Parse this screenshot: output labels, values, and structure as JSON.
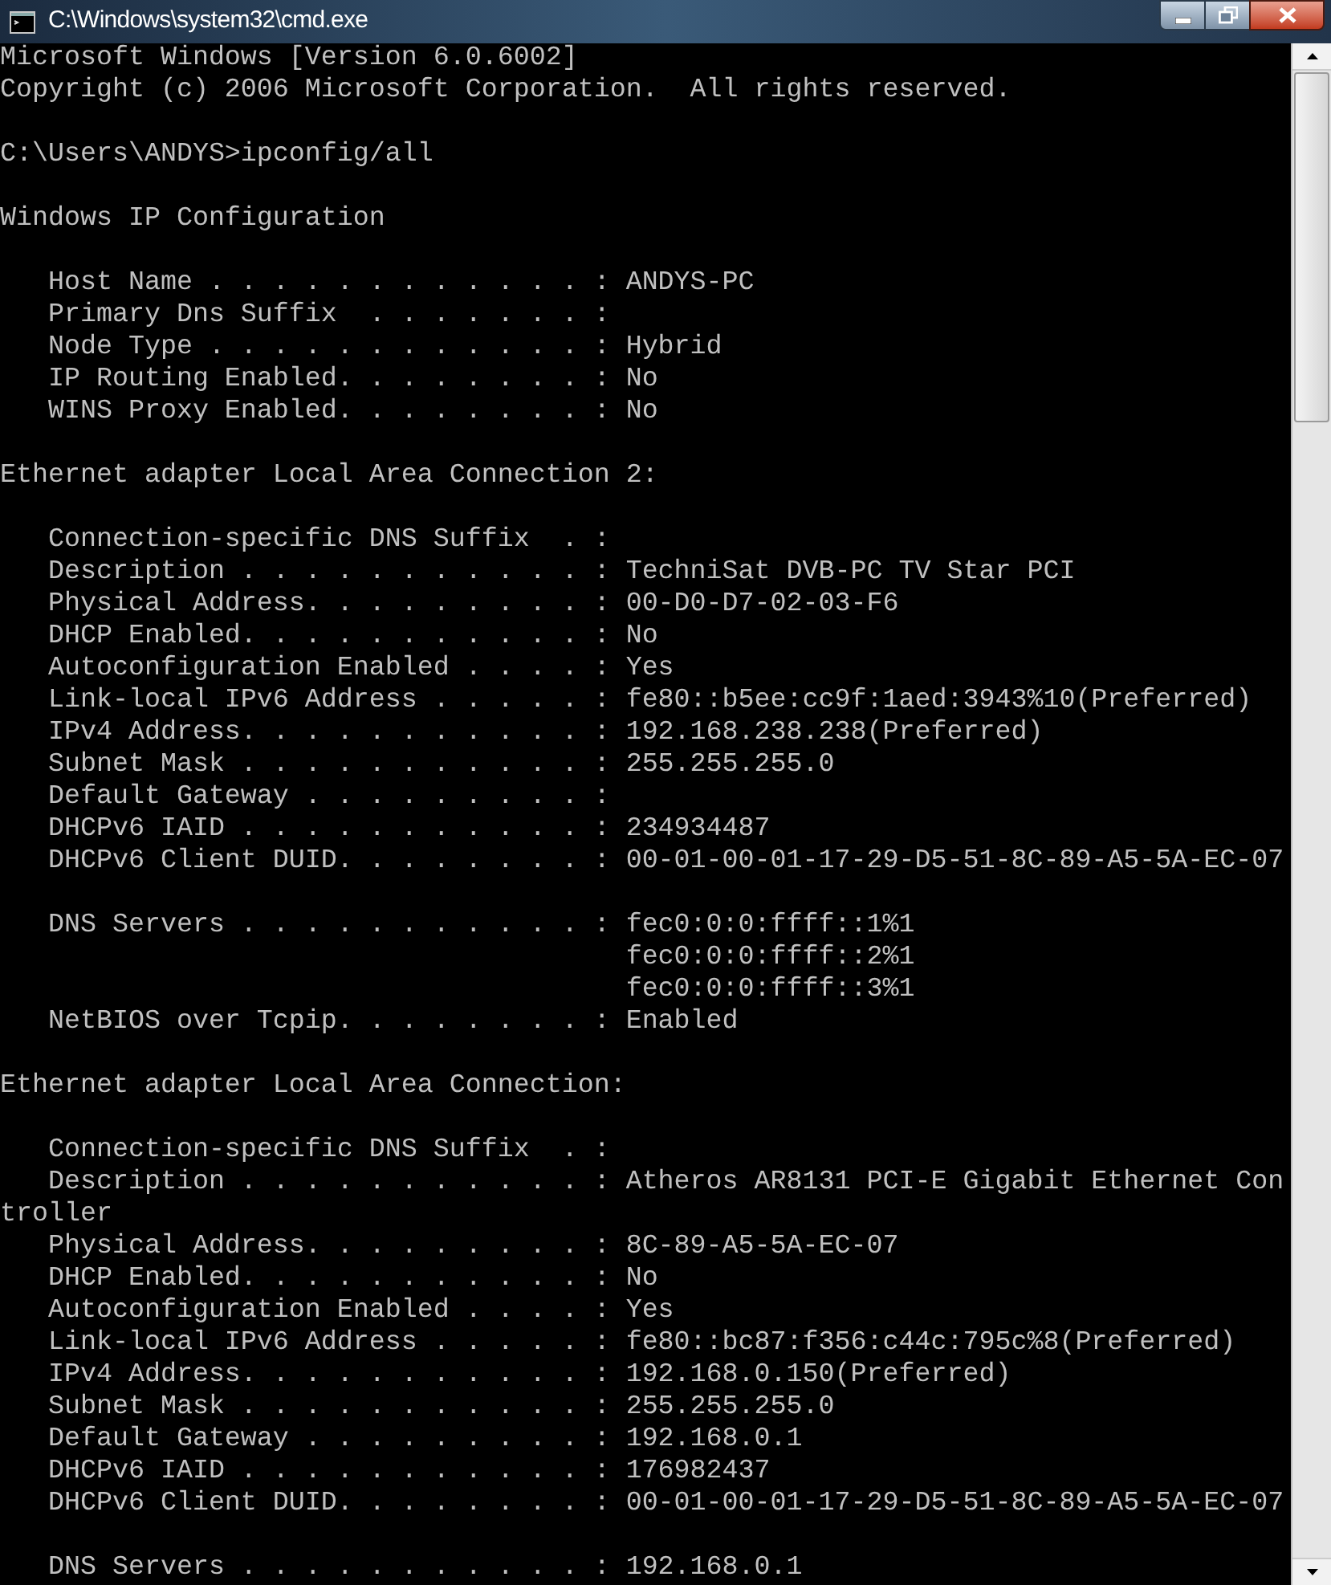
{
  "window": {
    "title": "C:\\Windows\\system32\\cmd.exe"
  },
  "console": {
    "blocks": [
      [
        "Microsoft Windows [Version 6.0.6002]",
        "Copyright (c) 2006 Microsoft Corporation.  All rights reserved."
      ],
      [
        "C:\\Users\\ANDYS>ipconfig/all"
      ],
      [
        "Windows IP Configuration"
      ],
      [
        "   Host Name . . . . . . . . . . . . : ANDYS-PC",
        "   Primary Dns Suffix  . . . . . . . :",
        "   Node Type . . . . . . . . . . . . : Hybrid",
        "   IP Routing Enabled. . . . . . . . : No",
        "   WINS Proxy Enabled. . . . . . . . : No"
      ],
      [
        "Ethernet adapter Local Area Connection 2:"
      ],
      [
        "   Connection-specific DNS Suffix  . :",
        "   Description . . . . . . . . . . . : TechniSat DVB-PC TV Star PCI",
        "   Physical Address. . . . . . . . . : 00-D0-D7-02-03-F6",
        "   DHCP Enabled. . . . . . . . . . . : No",
        "   Autoconfiguration Enabled . . . . : Yes",
        "   Link-local IPv6 Address . . . . . : fe80::b5ee:cc9f:1aed:3943%10(Preferred)",
        "   IPv4 Address. . . . . . . . . . . : 192.168.238.238(Preferred)",
        "   Subnet Mask . . . . . . . . . . . : 255.255.255.0",
        "   Default Gateway . . . . . . . . . :",
        "   DHCPv6 IAID . . . . . . . . . . . : 234934487",
        "   DHCPv6 Client DUID. . . . . . . . : 00-01-00-01-17-29-D5-51-8C-89-A5-5A-EC-07"
      ],
      [
        "   DNS Servers . . . . . . . . . . . : fec0:0:0:ffff::1%1",
        "                                       fec0:0:0:ffff::2%1",
        "                                       fec0:0:0:ffff::3%1",
        "   NetBIOS over Tcpip. . . . . . . . : Enabled"
      ],
      [
        "Ethernet adapter Local Area Connection:"
      ],
      [
        "   Connection-specific DNS Suffix  . :",
        "   Description . . . . . . . . . . . : Atheros AR8131 PCI-E Gigabit Ethernet Con",
        "troller",
        "   Physical Address. . . . . . . . . : 8C-89-A5-5A-EC-07",
        "   DHCP Enabled. . . . . . . . . . . : No",
        "   Autoconfiguration Enabled . . . . : Yes",
        "   Link-local IPv6 Address . . . . . : fe80::bc87:f356:c44c:795c%8(Preferred)",
        "   IPv4 Address. . . . . . . . . . . : 192.168.0.150(Preferred)",
        "   Subnet Mask . . . . . . . . . . . : 255.255.255.0",
        "   Default Gateway . . . . . . . . . : 192.168.0.1",
        "   DHCPv6 IAID . . . . . . . . . . . : 176982437",
        "   DHCPv6 Client DUID. . . . . . . . : 00-01-00-01-17-29-D5-51-8C-89-A5-5A-EC-07"
      ],
      [
        "   DNS Servers . . . . . . . . . . . : 192.168.0.1"
      ]
    ]
  }
}
